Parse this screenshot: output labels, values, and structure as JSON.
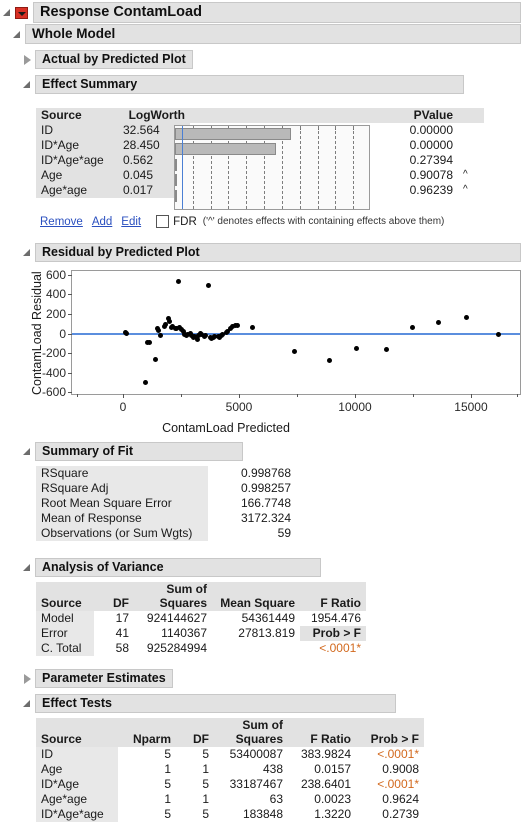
{
  "window": {
    "response_title": "Response ContamLoad",
    "whole_model_title": "Whole Model"
  },
  "sections": {
    "actual_by_predicted": "Actual by Predicted Plot",
    "effect_summary": "Effect Summary",
    "residual_by_predicted": "Residual by Predicted Plot",
    "summary_of_fit": "Summary of Fit",
    "analysis_of_variance": "Analysis of Variance",
    "parameter_estimates": "Parameter Estimates",
    "effect_tests": "Effect Tests"
  },
  "effect_summary": {
    "headers": {
      "source": "Source",
      "logworth": "LogWorth",
      "pvalue": "PValue"
    },
    "rows": [
      {
        "source": "ID",
        "logworth": "32.564",
        "pvalue": "0.00000",
        "caret": "",
        "bar": 32.564
      },
      {
        "source": "ID*Age",
        "logworth": "28.450",
        "pvalue": "0.00000",
        "caret": "",
        "bar": 28.45
      },
      {
        "source": "ID*Age*age",
        "logworth": "0.562",
        "pvalue": "0.27394",
        "caret": "",
        "bar": 0.562
      },
      {
        "source": "Age",
        "logworth": "0.045",
        "pvalue": "0.90078",
        "caret": "^",
        "bar": 0.045
      },
      {
        "source": "Age*age",
        "logworth": "0.017",
        "pvalue": "0.96239",
        "caret": "^",
        "bar": 0.017
      }
    ],
    "bar_axis_max": 55,
    "reference_logworth": 2.0,
    "gridline_step": 5,
    "links": {
      "remove": "Remove",
      "add": "Add",
      "edit": "Edit",
      "fdr": "FDR"
    },
    "note": "('^' denotes effects with containing effects above them)"
  },
  "chart_data": {
    "type": "scatter",
    "title": "Residual by Predicted Plot",
    "xlabel": "ContamLoad Predicted",
    "ylabel": "ContamLoad Residual",
    "xlim": [
      -2200,
      17200
    ],
    "ylim": [
      -640,
      640
    ],
    "xticks": [
      0,
      5000,
      10000,
      15000
    ],
    "yticks": [
      -600,
      -400,
      -200,
      0,
      200,
      400,
      600
    ],
    "reference_line_y": 0,
    "grid": false,
    "points": [
      [
        120,
        10
      ],
      [
        150,
        5
      ],
      [
        950,
        -500
      ],
      [
        1050,
        -90
      ],
      [
        1150,
        -95
      ],
      [
        1400,
        -265
      ],
      [
        1500,
        50
      ],
      [
        1550,
        35
      ],
      [
        1620,
        -20
      ],
      [
        1800,
        70
      ],
      [
        1850,
        95
      ],
      [
        1950,
        150
      ],
      [
        2000,
        120
      ],
      [
        2100,
        60
      ],
      [
        2150,
        70
      ],
      [
        2250,
        55
      ],
      [
        2300,
        50
      ],
      [
        2400,
        535
      ],
      [
        2450,
        60
      ],
      [
        2500,
        45
      ],
      [
        2600,
        20
      ],
      [
        2650,
        -10
      ],
      [
        2750,
        -25
      ],
      [
        2800,
        -15
      ],
      [
        2900,
        5
      ],
      [
        2950,
        -20
      ],
      [
        3050,
        -40
      ],
      [
        3100,
        -30
      ],
      [
        3200,
        -60
      ],
      [
        3250,
        -20
      ],
      [
        3350,
        -5
      ],
      [
        3400,
        -15
      ],
      [
        3500,
        -35
      ],
      [
        3550,
        -25
      ],
      [
        3700,
        490
      ],
      [
        3750,
        -45
      ],
      [
        3800,
        -55
      ],
      [
        3900,
        -40
      ],
      [
        3950,
        -30
      ],
      [
        4100,
        -35
      ],
      [
        4150,
        -45
      ],
      [
        4250,
        -20
      ],
      [
        4300,
        -10
      ],
      [
        4450,
        10
      ],
      [
        4500,
        25
      ],
      [
        4650,
        55
      ],
      [
        4700,
        70
      ],
      [
        4850,
        80
      ],
      [
        4950,
        85
      ],
      [
        5600,
        60
      ],
      [
        7400,
        -185
      ],
      [
        8900,
        -280
      ],
      [
        10050,
        -150
      ],
      [
        11350,
        -165
      ],
      [
        12500,
        65
      ],
      [
        13600,
        110
      ],
      [
        14800,
        165
      ],
      [
        16200,
        -10
      ]
    ]
  },
  "summary_of_fit": {
    "rows": [
      {
        "label": "RSquare",
        "value": "0.998768"
      },
      {
        "label": "RSquare Adj",
        "value": "0.998257"
      },
      {
        "label": "Root Mean Square Error",
        "value": "166.7748"
      },
      {
        "label": "Mean of Response",
        "value": "3172.324"
      },
      {
        "label": "Observations (or Sum Wgts)",
        "value": "59"
      }
    ]
  },
  "anova": {
    "headers": {
      "source": "Source",
      "df": "DF",
      "ss_line1": "Sum of",
      "ss_line2": "Squares",
      "ms": "Mean Square",
      "f": "F Ratio"
    },
    "rows": [
      {
        "source": "Model",
        "df": "17",
        "ss": "924144627",
        "ms": "54361449",
        "f": "1954.476"
      },
      {
        "source": "Error",
        "df": "41",
        "ss": "1140367",
        "ms": "27813.819",
        "f": "Prob > F"
      },
      {
        "source": "C. Total",
        "df": "58",
        "ss": "925284994",
        "ms": "",
        "f": "<.0001*"
      }
    ]
  },
  "effect_tests": {
    "headers": {
      "source": "Source",
      "nparm": "Nparm",
      "df": "DF",
      "ss_line1": "Sum of",
      "ss_line2": "Squares",
      "f": "F Ratio",
      "prob": "Prob > F"
    },
    "rows": [
      {
        "source": "ID",
        "nparm": "5",
        "df": "5",
        "ss": "53400087",
        "f": "383.9824",
        "prob": "<.0001*",
        "sig": true
      },
      {
        "source": "Age",
        "nparm": "1",
        "df": "1",
        "ss": "438",
        "f": "0.0157",
        "prob": "0.9008",
        "sig": false
      },
      {
        "source": "ID*Age",
        "nparm": "5",
        "df": "5",
        "ss": "33187467",
        "f": "238.6401",
        "prob": "<.0001*",
        "sig": true
      },
      {
        "source": "Age*age",
        "nparm": "1",
        "df": "1",
        "ss": "63",
        "f": "0.0023",
        "prob": "0.9624",
        "sig": false
      },
      {
        "source": "ID*Age*age",
        "nparm": "5",
        "df": "5",
        "ss": "183848",
        "f": "1.3220",
        "prob": "0.2739",
        "sig": false
      }
    ]
  },
  "colors": {
    "accent_red": "#d93025",
    "link_blue": "#2a4fbf",
    "ref_line_blue": "#5b8ede",
    "significant_orange": "#d2691e",
    "plate_gray": "#e2e2e2"
  }
}
